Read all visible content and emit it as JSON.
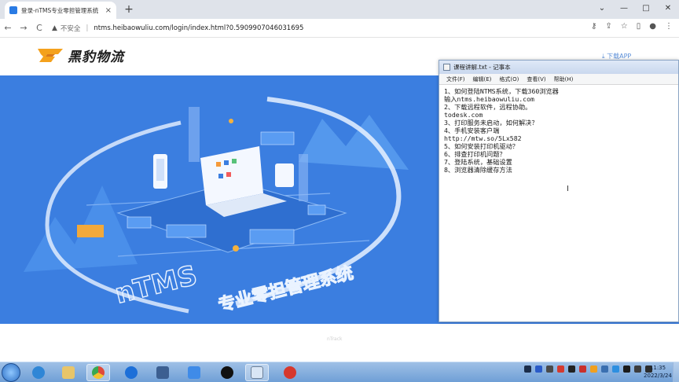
{
  "browser": {
    "tab_title": "登录-nTMS专业零担管理系统",
    "tab_close": "×",
    "new_tab": "+",
    "window_buttons": [
      "⌄",
      "—",
      "□",
      "✕"
    ],
    "nav": {
      "back": "←",
      "forward": "→",
      "reload": "C"
    },
    "security_label": "不安全",
    "url": "ntms.heibaowuliu.com/login/index.html?0.5909907046031695"
  },
  "page": {
    "logo_text": "黑豹物流",
    "download_link": "下载APP",
    "hero_brand": "nTMS",
    "hero_slogan": "专业零担管理系统",
    "footer_text": "nTrack"
  },
  "notepad": {
    "title": "课程讲解.txt - 记事本",
    "menu": [
      "文件(F)",
      "编辑(E)",
      "格式(O)",
      "查看(V)",
      "帮助(H)"
    ],
    "lines": [
      "1、如何登陆NTMS系统，下载360浏览器",
      "输入ntms.heibaowuliu.com",
      "2、下载远程软件，远程协助。",
      "todesk.com",
      "3、打印服务未启动，如何解决？",
      "4、手机安装客户端",
      "http://mtw.so/5Lx582",
      "5、如何安装打印机驱动？",
      "6、排查打印机问题？",
      "7、登陆系统，基础设置",
      "8、浏览器清除缓存方法"
    ],
    "cursor": "I"
  },
  "taskbar": {
    "clock_time": "11:35",
    "clock_date": "2022/3/24",
    "apps": [
      "ie-icon",
      "explorer-icon",
      "chrome-icon",
      "sogou-icon",
      "network-icon",
      "todesk-icon",
      "hidden-app-icon",
      "notepad-icon",
      "recorder-icon"
    ]
  }
}
